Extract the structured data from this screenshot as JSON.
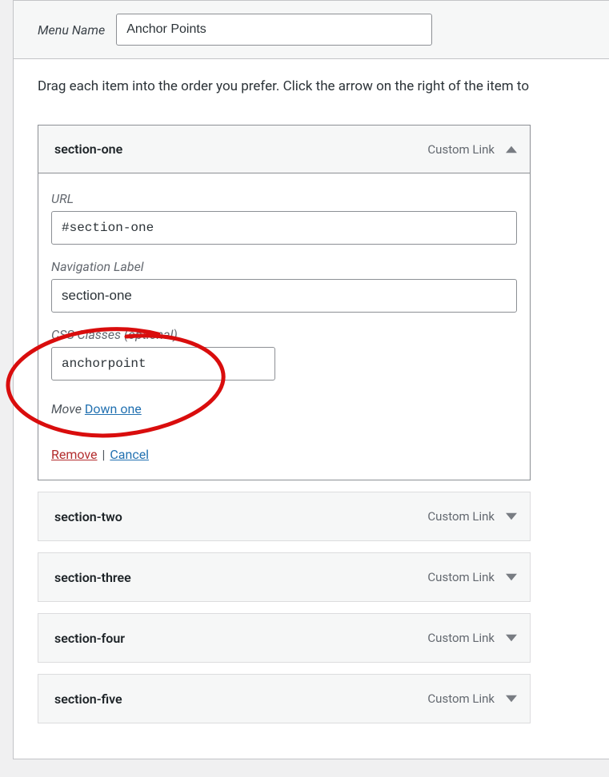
{
  "header": {
    "menu_name_label": "Menu Name",
    "menu_name_value": "Anchor Points"
  },
  "instructions": "Drag each item into the order you prefer. Click the arrow on the right of the item to",
  "custom_link_label": "Custom Link",
  "expanded_item": {
    "title": "section-one",
    "fields": {
      "url_label": "URL",
      "url_value": "#section-one",
      "nav_label_label": "Navigation Label",
      "nav_label_value": "section-one",
      "css_classes_label": "CSS Classes (optional)",
      "css_classes_value": "anchorpoint"
    },
    "move_label": "Move",
    "move_down_label": "Down one",
    "remove_label": "Remove",
    "cancel_label": "Cancel"
  },
  "collapsed_items": [
    {
      "title": "section-two"
    },
    {
      "title": "section-three"
    },
    {
      "title": "section-four"
    },
    {
      "title": "section-five"
    }
  ]
}
